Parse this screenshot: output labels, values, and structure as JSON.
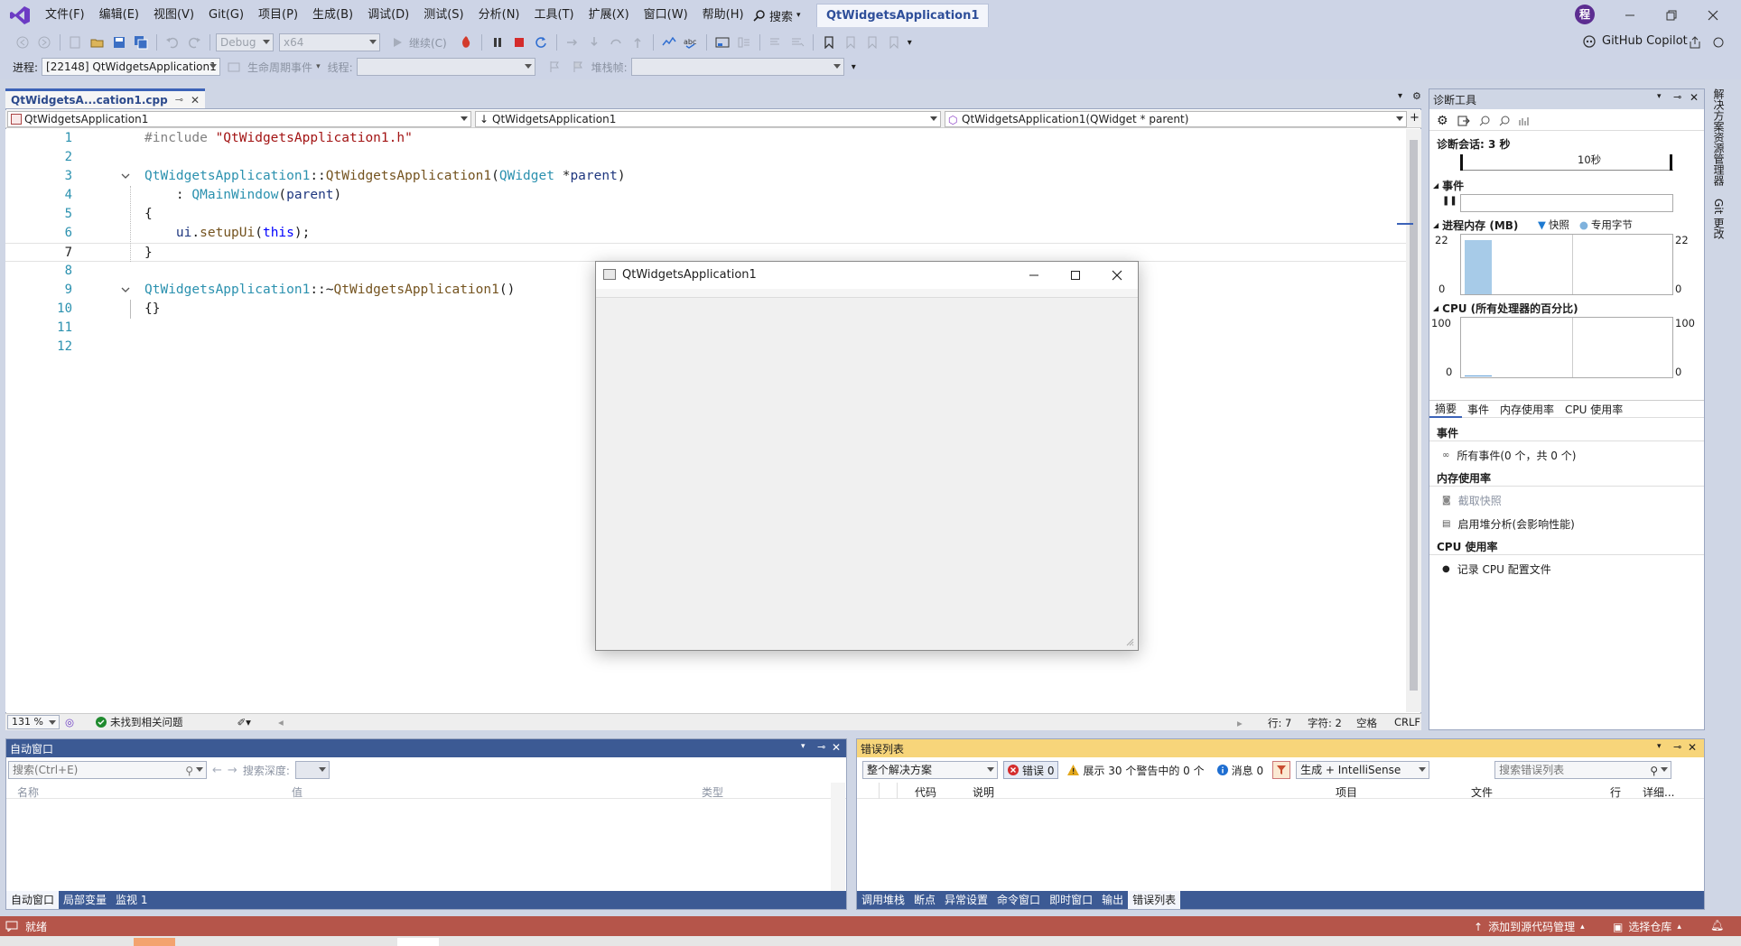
{
  "menu": {
    "items": [
      "文件(F)",
      "编辑(E)",
      "视图(V)",
      "Git(G)",
      "项目(P)",
      "生成(B)",
      "调试(D)",
      "测试(S)",
      "分析(N)",
      "工具(T)",
      "扩展(X)",
      "窗口(W)",
      "帮助(H)"
    ],
    "search_label": "搜索",
    "title_tab": "QtWidgetsApplication1",
    "avatar_letter": "程"
  },
  "toolbar": {
    "config": "Debug",
    "platform": "x64",
    "continue": "继续(C)",
    "copilot": "GitHub Copilot"
  },
  "toolbar2": {
    "process_label": "进程:",
    "process_value": "[22148] QtWidgetsApplication1",
    "lifecycle_label": "生命周期事件",
    "thread_label": "线程:",
    "stackframe_label": "堆栈帧:"
  },
  "editor": {
    "tab_title": "QtWidgetsA...cation1.cpp",
    "nav_project": "QtWidgetsApplication1",
    "nav_scope": "QtWidgetsApplication1",
    "nav_member": "QtWidgetsApplication1(QWidget * parent)",
    "active_line": 7,
    "lines": [
      {
        "n": "1",
        "tokens": [
          {
            "c": "pp",
            "t": "#include "
          },
          {
            "c": "str",
            "t": "\"QtWidgetsApplication1.h\""
          }
        ]
      },
      {
        "n": "2",
        "tokens": []
      },
      {
        "n": "3",
        "tokens": [
          {
            "c": "cls",
            "t": "QtWidgetsApplication1"
          },
          {
            "c": "plain",
            "t": "::"
          },
          {
            "c": "fn",
            "t": "QtWidgetsApplication1"
          },
          {
            "c": "plain",
            "t": "("
          },
          {
            "c": "cls",
            "t": "QWidget"
          },
          {
            "c": "plain",
            "t": " *"
          },
          {
            "c": "id",
            "t": "parent"
          },
          {
            "c": "plain",
            "t": ")"
          }
        ]
      },
      {
        "n": "4",
        "tokens": [
          {
            "c": "plain",
            "t": "    : "
          },
          {
            "c": "cls",
            "t": "QMainWindow"
          },
          {
            "c": "plain",
            "t": "("
          },
          {
            "c": "id",
            "t": "parent"
          },
          {
            "c": "plain",
            "t": ")"
          }
        ]
      },
      {
        "n": "5",
        "tokens": [
          {
            "c": "plain",
            "t": "{"
          }
        ]
      },
      {
        "n": "6",
        "tokens": [
          {
            "c": "plain",
            "t": "    "
          },
          {
            "c": "id",
            "t": "ui"
          },
          {
            "c": "plain",
            "t": "."
          },
          {
            "c": "fn",
            "t": "setupUi"
          },
          {
            "c": "plain",
            "t": "("
          },
          {
            "c": "kw",
            "t": "this"
          },
          {
            "c": "plain",
            "t": ");"
          }
        ]
      },
      {
        "n": "7",
        "tokens": [
          {
            "c": "plain",
            "t": "}"
          }
        ]
      },
      {
        "n": "8",
        "tokens": []
      },
      {
        "n": "9",
        "tokens": [
          {
            "c": "cls",
            "t": "QtWidgetsApplication1"
          },
          {
            "c": "plain",
            "t": "::~"
          },
          {
            "c": "fn",
            "t": "QtWidgetsApplication1"
          },
          {
            "c": "plain",
            "t": "()"
          }
        ]
      },
      {
        "n": "10",
        "tokens": [
          {
            "c": "plain",
            "t": "{}"
          }
        ]
      },
      {
        "n": "11",
        "tokens": []
      },
      {
        "n": "12",
        "tokens": []
      }
    ],
    "zoom": "131 %",
    "issues": "未找到相关问题",
    "position_line": "行: 7",
    "position_char": "字符: 2",
    "whitespace": "空格",
    "line_ending": "CRLF"
  },
  "qt_window": {
    "title": "QtWidgetsApplication1"
  },
  "diagnostics": {
    "title": "诊断工具",
    "session": "诊断会话: 3 秒",
    "timeline_tick": "10秒",
    "events_label": "事件",
    "memory_label": "进程内存 (MB)",
    "snapshot_legend": "快照",
    "private_bytes_legend": "专用字节",
    "mem_max": "22",
    "mem_min": "0",
    "cpu_label": "CPU (所有处理器的百分比)",
    "cpu_max": "100",
    "cpu_min": "0",
    "tabs": [
      "摘要",
      "事件",
      "内存使用率",
      "CPU 使用率"
    ],
    "events_section": "事件",
    "all_events": "所有事件(0 个，共 0 个)",
    "memory_section": "内存使用率",
    "take_snapshot": "截取快照",
    "heap_profiling": "启用堆分析(会影响性能)",
    "cpu_section": "CPU 使用率",
    "record_cpu": "记录 CPU 配置文件"
  },
  "side_tabs": [
    "解决方案资源管理器",
    "Git 更改"
  ],
  "autos": {
    "title": "自动窗口",
    "search_placeholder": "搜索(Ctrl+E)",
    "search_depth": "搜索深度:",
    "col_name": "名称",
    "col_value": "值",
    "col_type": "类型",
    "tabs": [
      "自动窗口",
      "局部变量",
      "监视 1"
    ]
  },
  "errors": {
    "title": "错误列表",
    "scope": "整个解决方案",
    "errors_btn": "错误 0",
    "warnings_btn": "展示 30 个警告中的 0 个",
    "messages_btn": "消息 0",
    "build_filter": "生成 + IntelliSense",
    "search_placeholder": "搜索错误列表",
    "col_code": "代码",
    "col_desc": "说明",
    "col_project": "项目",
    "col_file": "文件",
    "col_line": "行",
    "col_detail": "详细...",
    "tabs": [
      "调用堆栈",
      "断点",
      "异常设置",
      "命令窗口",
      "即时窗口",
      "输出",
      "错误列表"
    ]
  },
  "status": {
    "ready": "就绪",
    "add_source_control": "添加到源代码管理",
    "select_repo": "选择仓库"
  }
}
